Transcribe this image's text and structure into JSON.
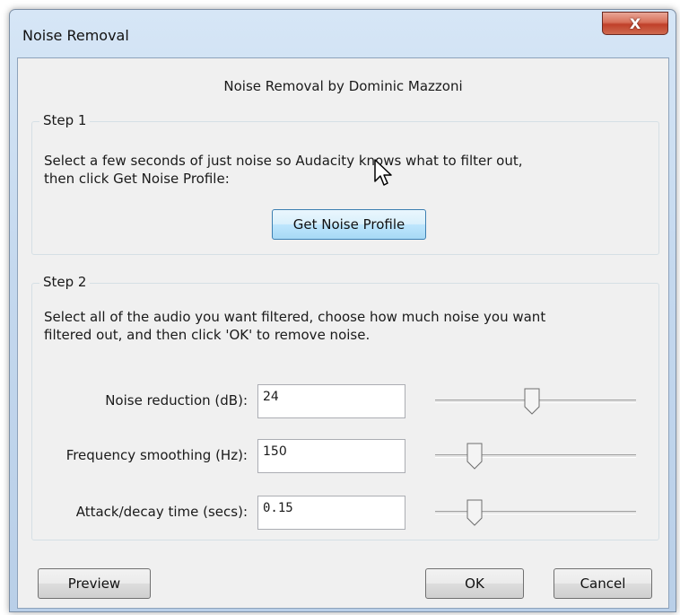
{
  "window": {
    "title": "Noise Removal",
    "close_label": "X"
  },
  "header": "Noise Removal by Dominic Mazzoni",
  "step1": {
    "legend": "Step 1",
    "line1": "Select a few seconds of just noise so Audacity knows what to filter out,",
    "line2": "then click Get Noise Profile:",
    "button_label": "Get Noise Profile"
  },
  "step2": {
    "legend": "Step 2",
    "line1": "Select all of the audio you want filtered, choose how much noise you want",
    "line2": "filtered out, and then click 'OK' to remove noise.",
    "fields": [
      {
        "label": "Noise reduction (dB):",
        "value": "24",
        "slider_fraction": 0.48
      },
      {
        "label": "Frequency smoothing (Hz):",
        "value": "150",
        "slider_fraction": 0.17
      },
      {
        "label": "Attack/decay time (secs):",
        "value": "0.15",
        "slider_fraction": 0.17
      }
    ]
  },
  "buttons": {
    "preview": "Preview",
    "ok": "OK",
    "cancel": "Cancel"
  },
  "colors": {
    "accent": "#3c7fb1",
    "close": "#c0402a"
  }
}
